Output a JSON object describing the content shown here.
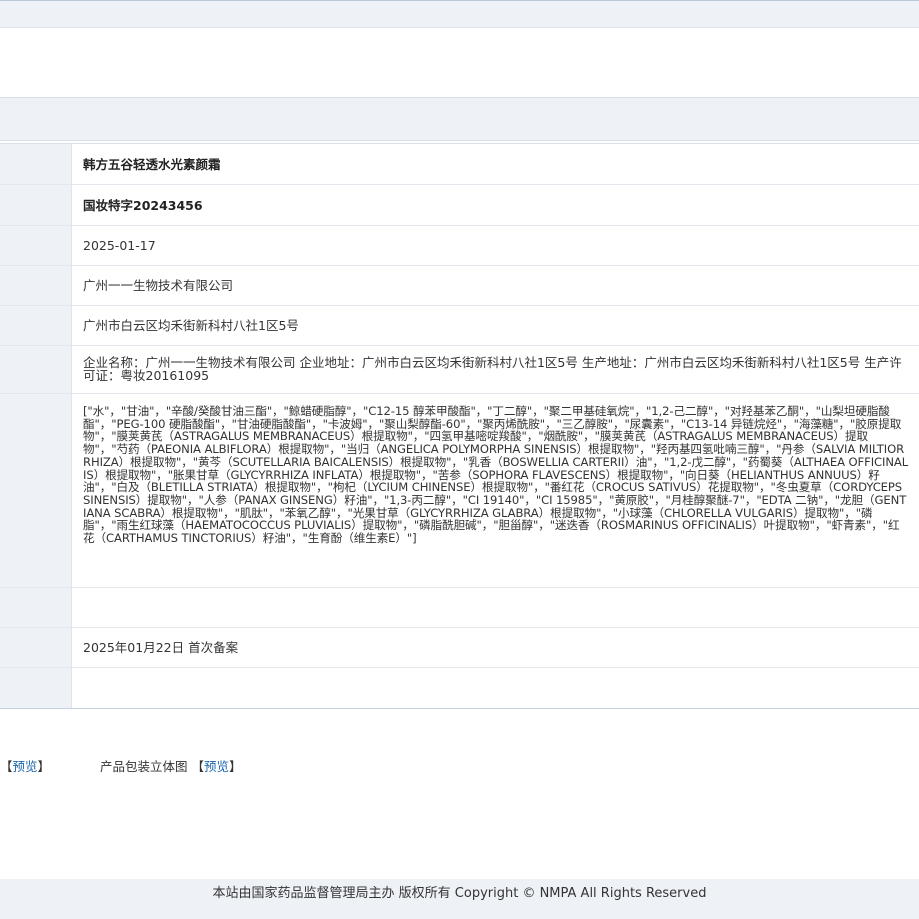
{
  "record": {
    "product_name": "韩方五谷轻透水光素颜霜",
    "registration_no": "国妆特字20243456",
    "approval_date": "2025-01-17",
    "company_name": "广州一一生物技术有限公司",
    "company_address": "广州市白云区均禾街新科村八社1区5号",
    "manufacturer_info": "企业名称：广州一一生物技术有限公司 企业地址：广州市白云区均禾街新科村八社1区5号 生产地址：广州市白云区均禾街新科村八社1区5号 生产许可证：粤妆20161095",
    "ingredients": "[\"水\"，\"甘油\"，\"辛酸/癸酸甘油三酯\"，\"鲸蜡硬脂醇\"，\"C12-15 醇苯甲酸酯\"，\"丁二醇\"，\"聚二甲基硅氧烷\"，\"1,2-己二醇\"，\"对羟基苯乙酮\"，\"山梨坦硬脂酸酯\"，\"PEG-100 硬脂酸酯\"，\"甘油硬脂酸酯\"，\"卡波姆\"，\"聚山梨醇酯-60\"，\"聚丙烯酰胺\"，\"三乙醇胺\"，\"尿囊素\"，\"C13-14 异链烷烃\"，\"海藻糖\"，\"胶原提取物\"，\"膜荚黄芪（ASTRAGALUS MEMBRANACEUS）根提取物\"，\"四氢甲基嘧啶羧酸\"，\"烟酰胺\"，\"膜荚黄芪（ASTRAGALUS MEMBRANACEUS）提取物\"，\"芍药（PAEONIA ALBIFLORA）根提取物\"，\"当归（ANGELICA POLYMORPHA SINENSIS）根提取物\"，\"羟丙基四氢吡喃三醇\"，\"丹参（SALVIA MILTIORRHIZA）根提取物\"，\"黄芩（SCUTELLARIA BAICALENSIS）根提取物\"，\"乳香（BOSWELLIA CARTERII）油\"，\"1,2-戊二醇\"，\"药蜀葵（ALTHAEA OFFICINALIS）根提取物\"，\"胀果甘草（GLYCYRRHIZA INFLATA）根提取物\"，\"苦参（SOPHORA FLAVESCENS）根提取物\"，\"向日葵（HELIANTHUS ANNUUS）籽油\"，\"白及（BLETILLA STRIATA）根提取物\"，\"枸杞（LYCIUM CHINENSE）根提取物\"，\"番红花（CROCUS SATIVUS）花提取物\"，\"冬虫夏草（CORDYCEPS SINENSIS）提取物\"，\"人参（PANAX GINSENG）籽油\"，\"1,3-丙二醇\"，\"CI 19140\"，\"CI 15985\"，\"黄原胶\"，\"月桂醇聚醚-7\"，\"EDTA 二钠\"，\"龙胆（GENTIANA SCABRA）根提取物\"，\"肌肽\"，\"苯氧乙醇\"，\"光果甘草（GLYCYRRHIZA GLABRA）根提取物\"，\"小球藻（CHLORELLA VULGARIS）提取物\"，\"磷脂\"，\"雨生红球藻（HAEMATOCOCCUS PLUVIALIS）提取物\"，\"磷脂酰胆碱\"，\"胆甾醇\"，\"迷迭香（ROSMARINUS OFFICINALIS）叶提取物\"，\"虾青素\"，\"红花（CARTHAMUS TINCTORIUS）籽油\"，\"生育酚（维生素E）\"]",
    "empty_value": "",
    "filing_note": "2025年01月22日 首次备案",
    "last_value": ""
  },
  "preview": {
    "bracket_open": "【",
    "bracket_close": "】",
    "preview_label": "预览",
    "package_label": "产品包装立体图"
  },
  "footer": {
    "text": "本站由国家药品监督管理局主办 版权所有 Copyright © NMPA All Rights Reserved"
  },
  "colors": {
    "label_bg": "#eef2f7",
    "link": "#1a66b0",
    "border": "#d7dfe8"
  }
}
